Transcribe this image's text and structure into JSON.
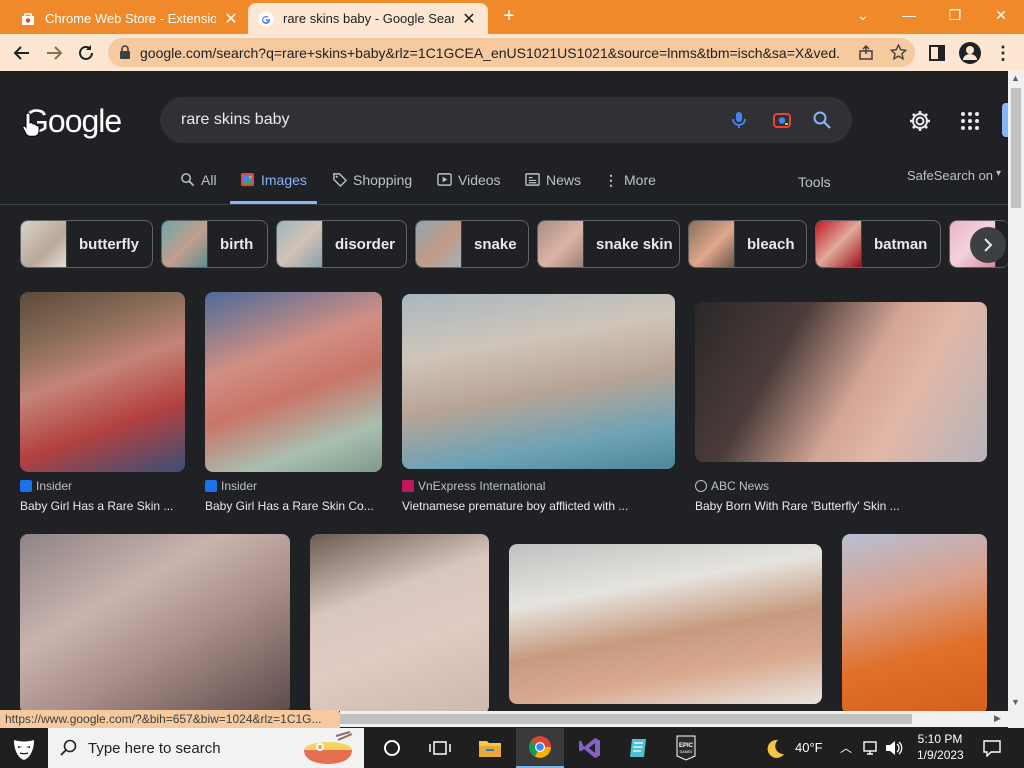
{
  "browser": {
    "tabs": [
      {
        "title": "Chrome Web Store - Extensions",
        "close": "✕"
      },
      {
        "title": "rare skins baby - Google Search",
        "close": "✕"
      }
    ],
    "new_tab": "+",
    "url": "google.com/search?q=rare+skins+baby&rlz=1C1GCEA_enUS1021US1021&source=lnms&tbm=isch&sa=X&ved...",
    "window_controls": {
      "menu": "⌄",
      "minimize": "—",
      "restore": "❐",
      "close": "✕"
    }
  },
  "google": {
    "logo": "Google",
    "query": "rare skins baby",
    "tabs": [
      "All",
      "Images",
      "Shopping",
      "Videos",
      "News",
      "More"
    ],
    "tools": "Tools",
    "safesearch": "SafeSearch on"
  },
  "chips": [
    "butterfly",
    "birth",
    "disorder",
    "snake",
    "snake skin",
    "bleach",
    "batman"
  ],
  "results": [
    {
      "source": "Insider",
      "caption": "Baby Girl Has a Rare Skin ..."
    },
    {
      "source": "Insider",
      "caption": "Baby Girl Has a Rare Skin Co..."
    },
    {
      "source": "VnExpress International",
      "caption": "Vietnamese premature boy afflicted with ..."
    },
    {
      "source": "ABC News",
      "caption": "Baby Born With Rare 'Butterfly' Skin ..."
    }
  ],
  "status_url": "https://www.google.com/?&bih=657&biw=1024&rlz=1C1G...",
  "taskbar": {
    "search_placeholder": "Type here to search",
    "weather": "40°F",
    "time": "5:10 PM",
    "date": "1/9/2023"
  },
  "colors": {
    "tab_bar": "#f0892a",
    "address_bar": "#fde7d2",
    "page_bg": "#202124",
    "accent": "#8ab4f8"
  }
}
